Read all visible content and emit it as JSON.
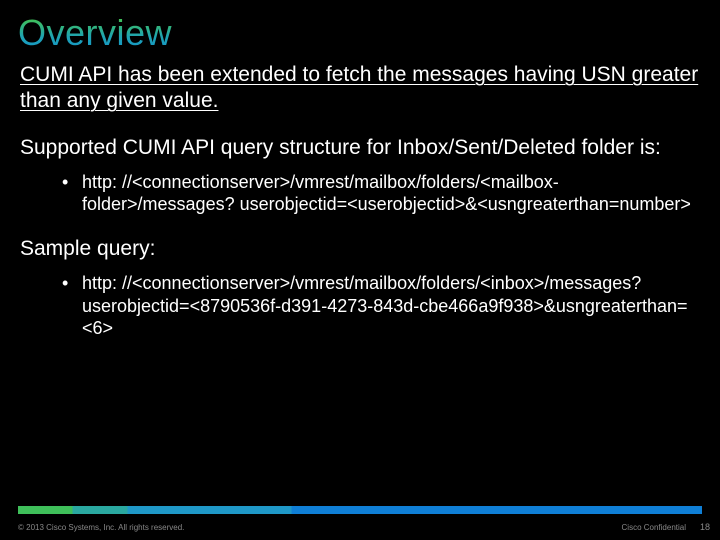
{
  "title": "Overview",
  "intro": "CUMI API has been extended to fetch the messages having USN greater than any given value.",
  "supported_label": "Supported CUMI API query structure for Inbox/Sent/Deleted folder is:",
  "query_template": "http: //<connectionserver>/vmrest/mailbox/folders/<mailbox-folder>/messages? userobjectid=<userobjectid>&<usngreaterthan=number>",
  "sample_label": "Sample query:",
  "sample_query": "http: //<connectionserver>/vmrest/mailbox/folders/<inbox>/messages? userobjectid=<8790536f-d391-4273-843d-cbe466a9f938>&usngreaterthan=<6>",
  "footer": {
    "copyright": "© 2013 Cisco Systems, Inc. All rights reserved.",
    "confidential": "Cisco Confidential",
    "page": "18"
  }
}
